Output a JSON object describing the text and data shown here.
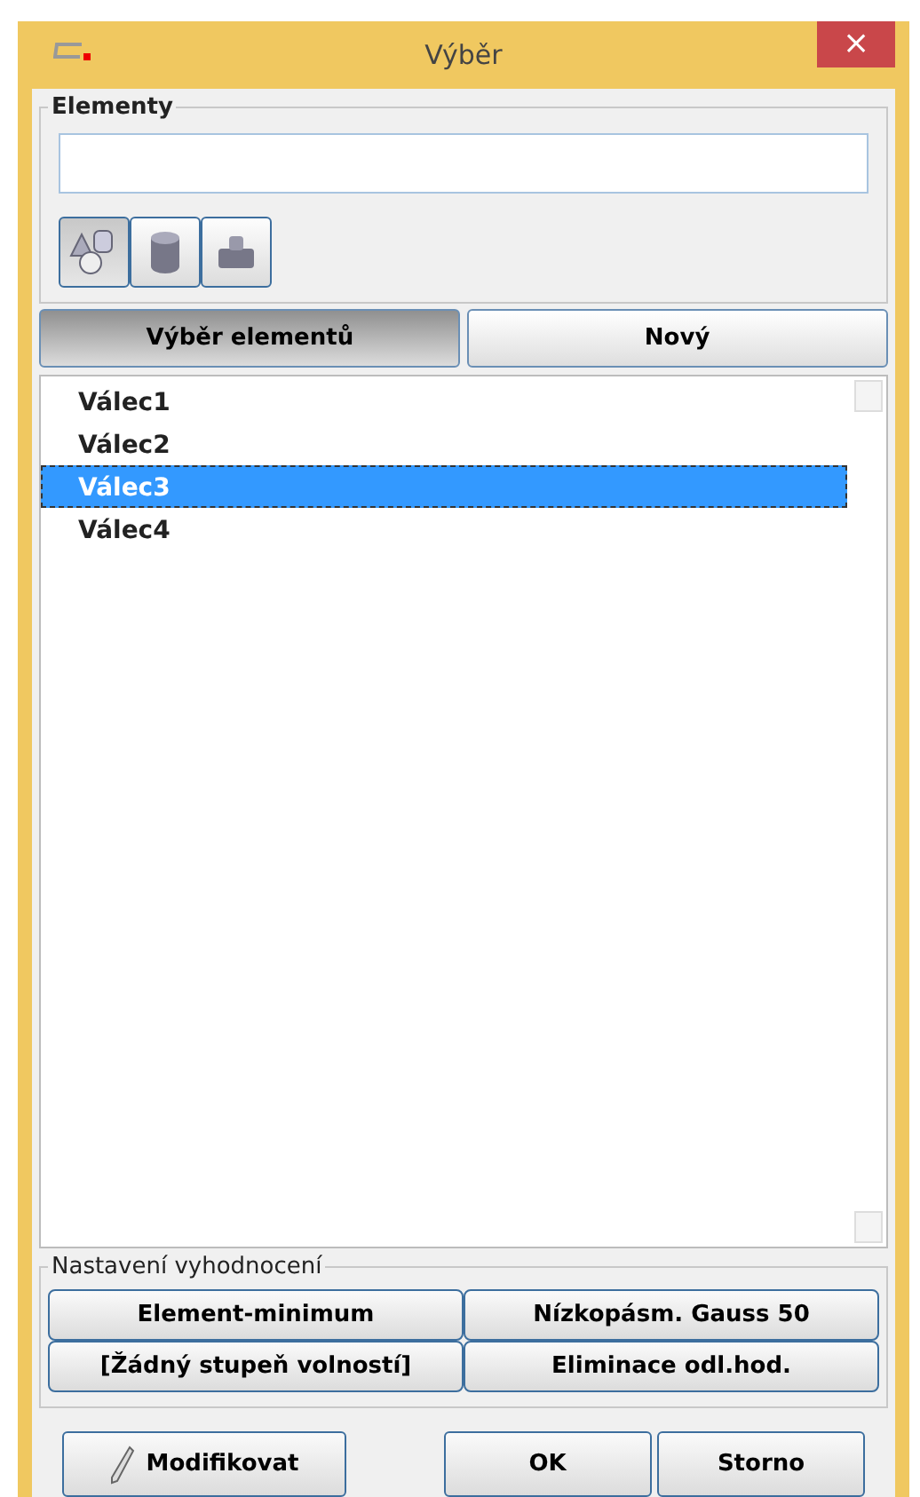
{
  "window": {
    "title": "Výběr",
    "close": "×"
  },
  "elements_group": {
    "label": "Elementy",
    "tool_buttons": [
      {
        "kind": "shapes",
        "selected": true
      },
      {
        "kind": "cylinder",
        "selected": false
      },
      {
        "kind": "stack",
        "selected": false
      }
    ]
  },
  "tabs": [
    {
      "label": "Výběr elementů",
      "selected": true
    },
    {
      "label": "Nový",
      "selected": false
    }
  ],
  "list": [
    {
      "label": "Válec1",
      "selected": false
    },
    {
      "label": "Válec2",
      "selected": false
    },
    {
      "label": "Válec3",
      "selected": true
    },
    {
      "label": "Válec4",
      "selected": false
    }
  ],
  "evaluation_group": {
    "label": "Nastavení vyhodnocení",
    "buttons": [
      "Element-minimum",
      "Nízkopásm. Gauss 50",
      "[Žádný stupeň volností]",
      "Eliminace odl.hod."
    ]
  },
  "footer": {
    "modify": "Modifikovat",
    "ok": "OK",
    "cancel": "Storno"
  }
}
